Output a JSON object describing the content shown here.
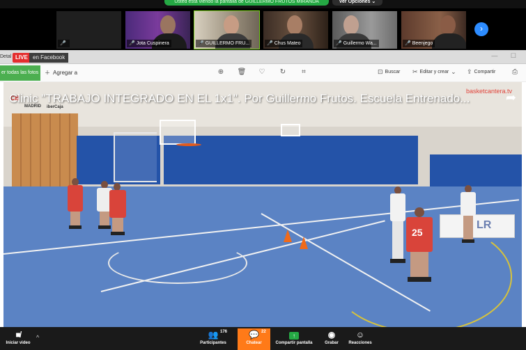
{
  "banner": {
    "share_notice": "Usted está viendo la pantalla de GUILLERMO FRUTOS MIRANDA",
    "view_options": "Ver Opciones ⌄"
  },
  "participants": [
    {
      "name": "",
      "muted": true
    },
    {
      "name": "Jota Cuspinera",
      "muted": true
    },
    {
      "name": "GUILLERMO FRU...",
      "muted": true,
      "active": true
    },
    {
      "name": "Chus Mateo",
      "muted": true
    },
    {
      "name": "Guillermo Wa...",
      "muted": true
    },
    {
      "name": "Beenjego",
      "muted": true
    }
  ],
  "fb": {
    "details": "Detal",
    "live": "LIVE",
    "live_text": "en Facebook",
    "see_all": "er todas las fotos",
    "add_to": "Agregar a",
    "search": "Buscar",
    "edit_create": "Editar y crear",
    "share": "Compartir"
  },
  "video": {
    "title": "Clinic \"TRABAJO INTEGRADO EN EL 1x1\". Por Guillermo Frutos. Escuela Entrenado...",
    "site": "basketcantera.tv",
    "brand": "CB",
    "brand_sub": "MADRID",
    "brand_sub2": "iberCaja",
    "jersey_number": "25",
    "ad_text": "LR"
  },
  "toolbar": {
    "start_video": "Iniciar video",
    "participants": "Participantes",
    "participants_count": "176",
    "chat": "Chatear",
    "chat_count": "22",
    "share_screen": "Compartir pantalla",
    "record": "Grabar",
    "reactions": "Reacciones"
  },
  "colors": {
    "zoom_blue": "#2d8cff",
    "share_green": "#25a844",
    "chat_orange": "#ff7a18",
    "live_red": "#e42e2e",
    "court_blue": "#5b83c4"
  }
}
